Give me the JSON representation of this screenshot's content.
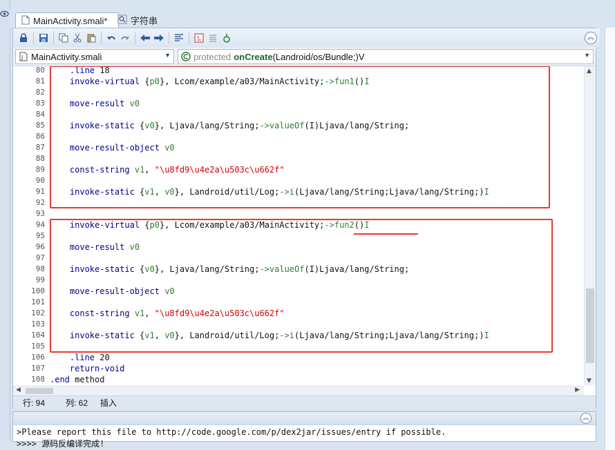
{
  "tabs": [
    {
      "label": "MainActivity.smali*",
      "icon": "file-icon"
    },
    {
      "label": "字符串",
      "icon": "strings-icon"
    }
  ],
  "toolbar": {
    "buttons": [
      "lock-icon",
      "save-icon",
      "copy-icon",
      "cut-icon",
      "paste-icon",
      "undo-icon",
      "redo-icon",
      "back-icon",
      "forward-icon",
      "format-icon",
      "java-icon",
      "list-icon",
      "gradle-icon"
    ]
  },
  "file_selector": {
    "value": "MainActivity.smali"
  },
  "method_selector": {
    "modifier": "protected",
    "name": "onCreate",
    "signature": "(Landroid/os/Bundle;)V"
  },
  "code": {
    "lines": [
      {
        "n": "80",
        "text": ".line 18"
      },
      {
        "n": "81",
        "text": "invoke-virtual {p0}, Lcom/example/a03/MainActivity;->fun1()I"
      },
      {
        "n": "82",
        "text": ""
      },
      {
        "n": "83",
        "text": "move-result v0"
      },
      {
        "n": "84",
        "text": ""
      },
      {
        "n": "85",
        "text": "invoke-static {v0}, Ljava/lang/String;->valueOf(I)Ljava/lang/String;"
      },
      {
        "n": "86",
        "text": ""
      },
      {
        "n": "87",
        "text": "move-result-object v0"
      },
      {
        "n": "88",
        "text": ""
      },
      {
        "n": "89",
        "text": "const-string v1, \"\\u8fd9\\u4e2a\\u503c\\u662f\""
      },
      {
        "n": "90",
        "text": ""
      },
      {
        "n": "91",
        "text": "invoke-static {v1, v0}, Landroid/util/Log;->i(Ljava/lang/String;Ljava/lang/String;)I"
      },
      {
        "n": "92",
        "text": ""
      },
      {
        "n": "93",
        "text": ""
      },
      {
        "n": "94",
        "text": "invoke-virtual {p0}, Lcom/example/a03/MainActivity;->fun2()I"
      },
      {
        "n": "95",
        "text": ""
      },
      {
        "n": "96",
        "text": "move-result v0"
      },
      {
        "n": "97",
        "text": ""
      },
      {
        "n": "98",
        "text": "invoke-static {v0}, Ljava/lang/String;->valueOf(I)Ljava/lang/String;"
      },
      {
        "n": "99",
        "text": ""
      },
      {
        "n": "100",
        "text": "move-result-object v0"
      },
      {
        "n": "101",
        "text": ""
      },
      {
        "n": "102",
        "text": "const-string v1, \"\\u8fd9\\u4e2a\\u503c\\u662f\""
      },
      {
        "n": "103",
        "text": ""
      },
      {
        "n": "104",
        "text": "invoke-static {v1, v0}, Landroid/util/Log;->i(Ljava/lang/String;Ljava/lang/String;)I"
      },
      {
        "n": "105",
        "text": ""
      },
      {
        "n": "106",
        "text": ".line 20"
      },
      {
        "n": "107",
        "text": "return-void"
      },
      {
        "n": "108",
        "text": ".end method"
      }
    ]
  },
  "status": {
    "row_label": "行: 94",
    "col_label": "列: 62",
    "mode": "插入"
  },
  "console": {
    "line1": ">Please report this file to http://code.google.com/p/dex2jar/issues/entry if possible.",
    "line2": ">>>> 源码反编译完成!"
  },
  "colors": {
    "highlight": "#e53935",
    "accent": "#2f5f9d"
  }
}
